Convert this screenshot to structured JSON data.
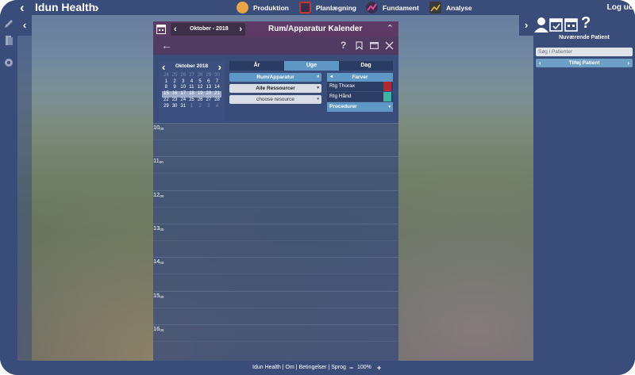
{
  "app": {
    "title": "Idun Health",
    "logout": "Log ud"
  },
  "modules": [
    {
      "label": "Produktion",
      "icon": "production-icon",
      "color": "#e8a54a"
    },
    {
      "label": "Planlægning",
      "icon": "calendar-icon",
      "color": "#c0392b"
    },
    {
      "label": "Fundament",
      "icon": "chart-line-icon",
      "color": "#a0327c"
    },
    {
      "label": "Analyse",
      "icon": "analysis-chart-icon",
      "color": "#d8b844"
    }
  ],
  "calendar": {
    "title": "Rum/Apparatur Kalender",
    "date_selector": "Oktober - 2018",
    "mini": {
      "month": "Oktober 2018",
      "rows": [
        [
          "24",
          "25",
          "26",
          "27",
          "28",
          "29",
          "30"
        ],
        [
          "1",
          "2",
          "3",
          "4",
          "5",
          "6",
          "7"
        ],
        [
          "8",
          "9",
          "10",
          "11",
          "12",
          "13",
          "14"
        ],
        [
          "15",
          "16",
          "17",
          "18",
          "19",
          "20",
          "21"
        ],
        [
          "22",
          "23",
          "24",
          "25",
          "26",
          "27",
          "28"
        ],
        [
          "29",
          "30",
          "31",
          "1",
          "2",
          "3",
          "4"
        ]
      ]
    },
    "views": {
      "year": "År",
      "week": "Uge",
      "day": "Dag"
    },
    "dropdowns": {
      "type": "Rum/Apparatur",
      "resources": "Alle Ressourcer",
      "choose": "choose resource"
    },
    "colors": {
      "header": "Farver",
      "rows": [
        {
          "label": "Rtg Thorax",
          "color": "#b2283a"
        },
        {
          "label": "Rtg Hånd",
          "color": "#3fb2a6"
        }
      ],
      "procedures": "Procedurer"
    },
    "hours": [
      {
        "h": "10",
        "m": "00"
      },
      {
        "h": "11",
        "m": "00"
      },
      {
        "h": "12",
        "m": "00"
      },
      {
        "h": "13",
        "m": "00"
      },
      {
        "h": "14",
        "m": "00"
      },
      {
        "h": "15",
        "m": "00"
      },
      {
        "h": "16",
        "m": "00"
      }
    ]
  },
  "patient": {
    "header": "Nuværende Patient",
    "search_placeholder": "Søg i Patienter",
    "add": "Tilføj Patient"
  },
  "footer": {
    "text": "Idun Health | Om | Betingelser | Sprog",
    "zoom": "100%",
    "minus": "−",
    "plus": "+"
  }
}
